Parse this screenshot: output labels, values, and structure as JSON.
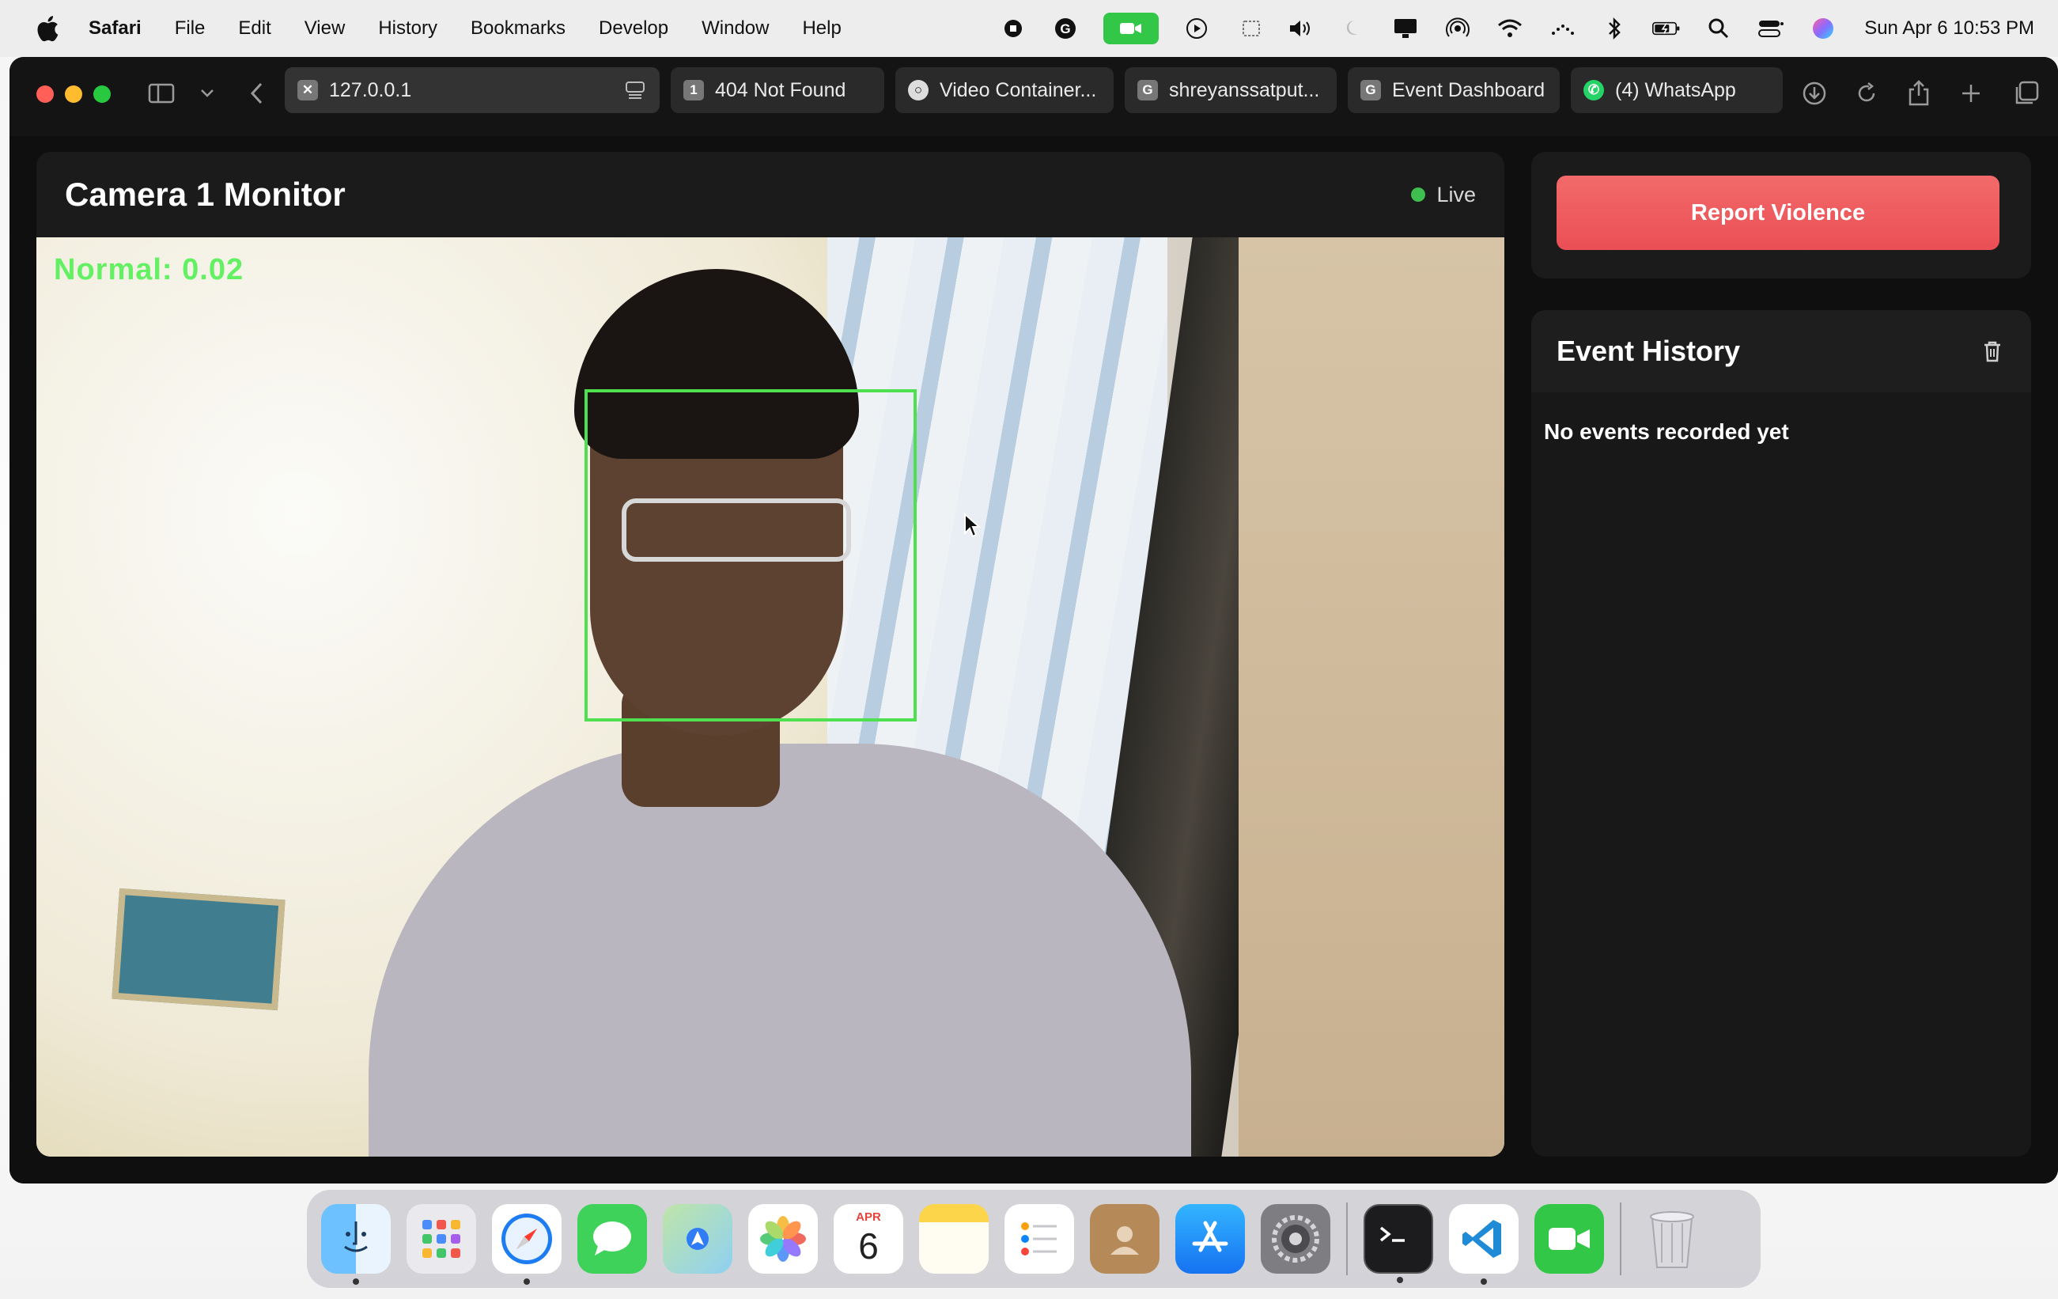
{
  "menubar": {
    "app_name": "Safari",
    "items": [
      "File",
      "Edit",
      "View",
      "History",
      "Bookmarks",
      "Develop",
      "Window",
      "Help"
    ],
    "datetime": "Sun Apr 6  10:53 PM"
  },
  "tabs": [
    {
      "label": "127.0.0.1",
      "favicon": "x"
    },
    {
      "label": "404 Not Found",
      "favicon": "1"
    },
    {
      "label": "Video Container...",
      "favicon": "github-icon"
    },
    {
      "label": "shreyanssatput...",
      "favicon": "G"
    },
    {
      "label": "Event Dashboard",
      "favicon": "G"
    },
    {
      "label": "(4) WhatsApp",
      "favicon": "whatsapp-icon"
    }
  ],
  "monitor": {
    "title": "Camera 1 Monitor",
    "status": "Live",
    "status_color": "#3fbf4f",
    "overlay_label": "Normal:  0.02",
    "overlay_color": "#63f063",
    "box_color": "#4ee04e"
  },
  "actions": {
    "report_label": "Report Violence",
    "accent": "#ea4f55"
  },
  "history": {
    "title": "Event History",
    "empty_message": "No events recorded yet"
  },
  "dock": {
    "calendar_month": "APR",
    "calendar_day": "6",
    "apps": [
      "Finder",
      "Launchpad",
      "Safari",
      "Messages",
      "Maps",
      "Photos",
      "Calendar",
      "Notes",
      "Reminders",
      "Contacts",
      "App Store",
      "System Settings",
      "Terminal",
      "Visual Studio Code",
      "FaceTime",
      "Trash"
    ]
  }
}
